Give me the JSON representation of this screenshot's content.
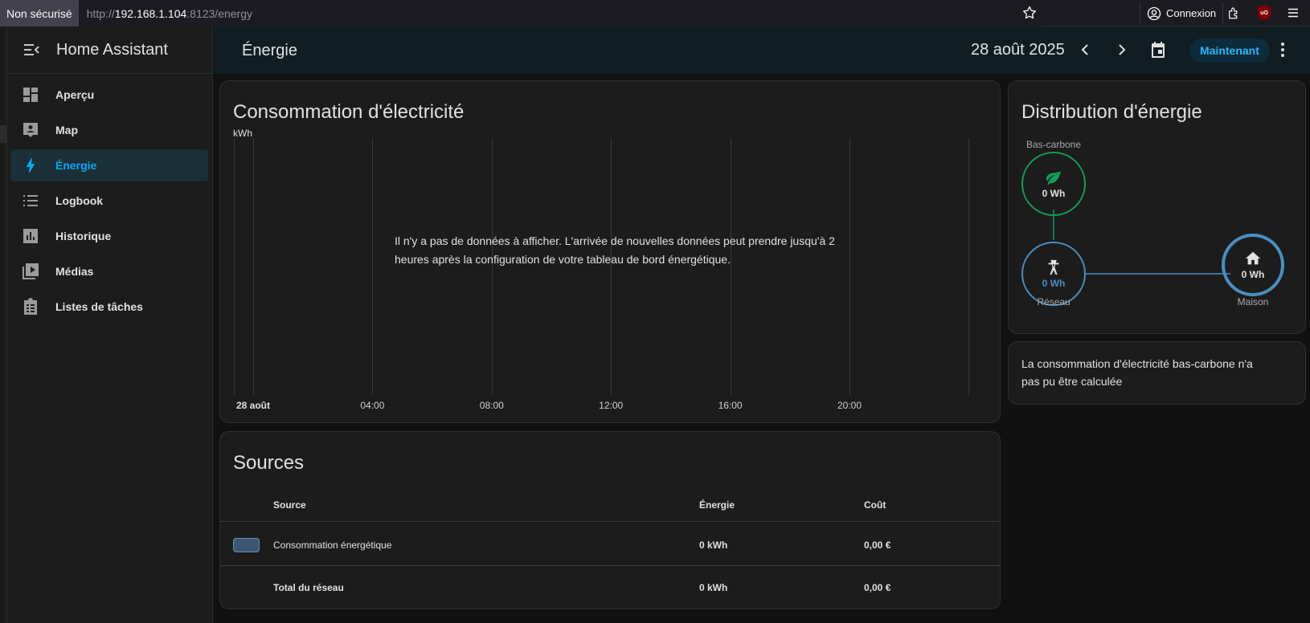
{
  "browser": {
    "security_label": "Non sécurisé",
    "url_prefix": "http://",
    "url_host": "192.168.1.104",
    "url_rest": ":8123/energy",
    "login_label": "Connexion",
    "ublock_label": "uO"
  },
  "sidebar": {
    "title": "Home Assistant",
    "items": [
      {
        "label": "Aperçu",
        "icon": "dashboard-icon"
      },
      {
        "label": "Map",
        "icon": "map-account-icon"
      },
      {
        "label": "Énergie",
        "icon": "lightning-bolt-icon",
        "active": true
      },
      {
        "label": "Logbook",
        "icon": "list-icon"
      },
      {
        "label": "Historique",
        "icon": "chart-box-icon"
      },
      {
        "label": "Médias",
        "icon": "play-box-multiple-icon"
      },
      {
        "label": "Listes de tâches",
        "icon": "clipboard-list-icon"
      }
    ]
  },
  "header": {
    "title": "Énergie",
    "date": "28 août 2025",
    "now_label": "Maintenant"
  },
  "consumption": {
    "title": "Consommation d'électricité",
    "no_data": "Il n'y a pas de données à afficher. L'arrivée de nouvelles données peut prendre jusqu'à 2 heures après la configuration de votre tableau de bord énergétique."
  },
  "chart_data": {
    "type": "bar",
    "title": "Consommation d'électricité",
    "ylabel": "kWh",
    "xlabel": "",
    "x_ticks": [
      "28 août",
      "04:00",
      "08:00",
      "12:00",
      "16:00",
      "20:00"
    ],
    "series": [],
    "grid": true
  },
  "sources": {
    "title": "Sources",
    "headers": {
      "source": "Source",
      "energy": "Énergie",
      "cost": "Coût"
    },
    "rows": [
      {
        "name": "Consommation énergétique",
        "energy": "0 kWh",
        "cost": "0,00 €",
        "color": "#3b5772"
      }
    ],
    "total": {
      "name": "Total du réseau",
      "energy": "0 kWh",
      "cost": "0,00 €"
    }
  },
  "distribution": {
    "title": "Distribution d'énergie",
    "low_carbon": {
      "label": "Bas-carbone",
      "value": "0 Wh",
      "color": "#0f9d58"
    },
    "grid": {
      "label": "Réseau",
      "value": "0 Wh",
      "color": "#488fc2"
    },
    "home": {
      "label": "Maison",
      "value": "0 Wh",
      "color": "#488fc2"
    }
  },
  "low_carbon_info": "La consommation d'électricité bas-carbone n'a pas pu être calculée",
  "colors": {
    "accent": "#03a9f4",
    "background": "#111111",
    "card": "#1c1c1c"
  }
}
